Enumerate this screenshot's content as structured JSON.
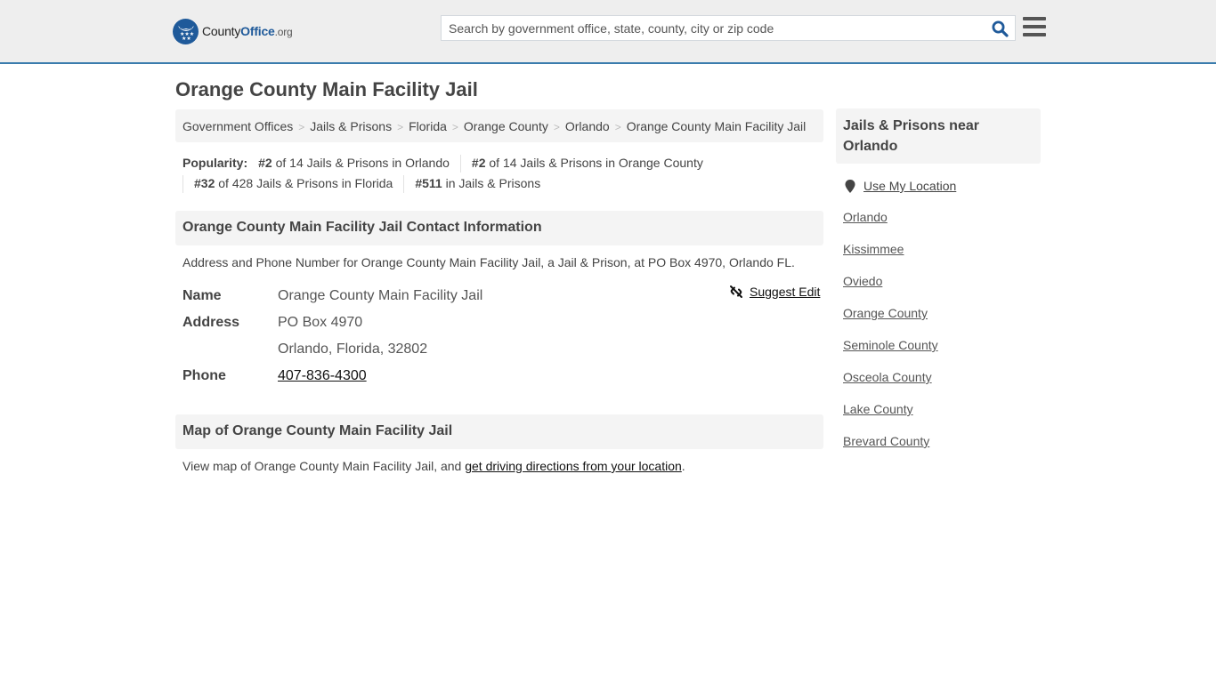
{
  "header": {
    "logo": {
      "part1": "County",
      "part2": "Office",
      "part3": ".org"
    },
    "search": {
      "placeholder": "Search by government office, state, county, city or zip code",
      "value": ""
    },
    "icons": {
      "search": "search-icon",
      "menu": "hamburger-menu-icon",
      "logo": "eagle-stars-badge-icon"
    },
    "colors": {
      "accent": "#1f5a9a",
      "border": "#3a7cad"
    }
  },
  "page": {
    "title": "Orange County Main Facility Jail"
  },
  "breadcrumb": [
    {
      "label": "Government Offices"
    },
    {
      "label": "Jails & Prisons"
    },
    {
      "label": "Florida"
    },
    {
      "label": "Orange County"
    },
    {
      "label": "Orlando"
    },
    {
      "label": "Orange County Main Facility Jail"
    }
  ],
  "popularity": {
    "label": "Popularity:",
    "items": [
      {
        "rank": "#2",
        "text": " of 14 Jails & Prisons in Orlando"
      },
      {
        "rank": "#2",
        "text": " of 14 Jails & Prisons in Orange County"
      },
      {
        "rank": "#32",
        "text": " of 428 Jails & Prisons in Florida"
      },
      {
        "rank": "#511",
        "text": " in Jails & Prisons"
      }
    ]
  },
  "contact": {
    "heading": "Orange County Main Facility Jail Contact Information",
    "description": "Address and Phone Number for Orange County Main Facility Jail, a Jail & Prison, at PO Box 4970, Orlando FL.",
    "suggest_edit": "Suggest Edit",
    "rows": {
      "name_label": "Name",
      "name_value": "Orange County Main Facility Jail",
      "address_label": "Address",
      "address_line1": "PO Box 4970",
      "address_line2": "Orlando, Florida, 32802",
      "phone_label": "Phone",
      "phone_value": "407-836-4300"
    }
  },
  "map": {
    "heading": "Map of Orange County Main Facility Jail",
    "desc_prefix": "View map of Orange County Main Facility Jail, and ",
    "desc_link": "get driving directions from your location",
    "desc_suffix": "."
  },
  "sidebar": {
    "heading": "Jails & Prisons near Orlando",
    "use_location": "Use My Location",
    "links": [
      {
        "label": "Orlando"
      },
      {
        "label": "Kissimmee"
      },
      {
        "label": "Oviedo"
      },
      {
        "label": "Orange County"
      },
      {
        "label": "Seminole County"
      },
      {
        "label": "Osceola County"
      },
      {
        "label": "Lake County"
      },
      {
        "label": "Brevard County"
      }
    ]
  }
}
